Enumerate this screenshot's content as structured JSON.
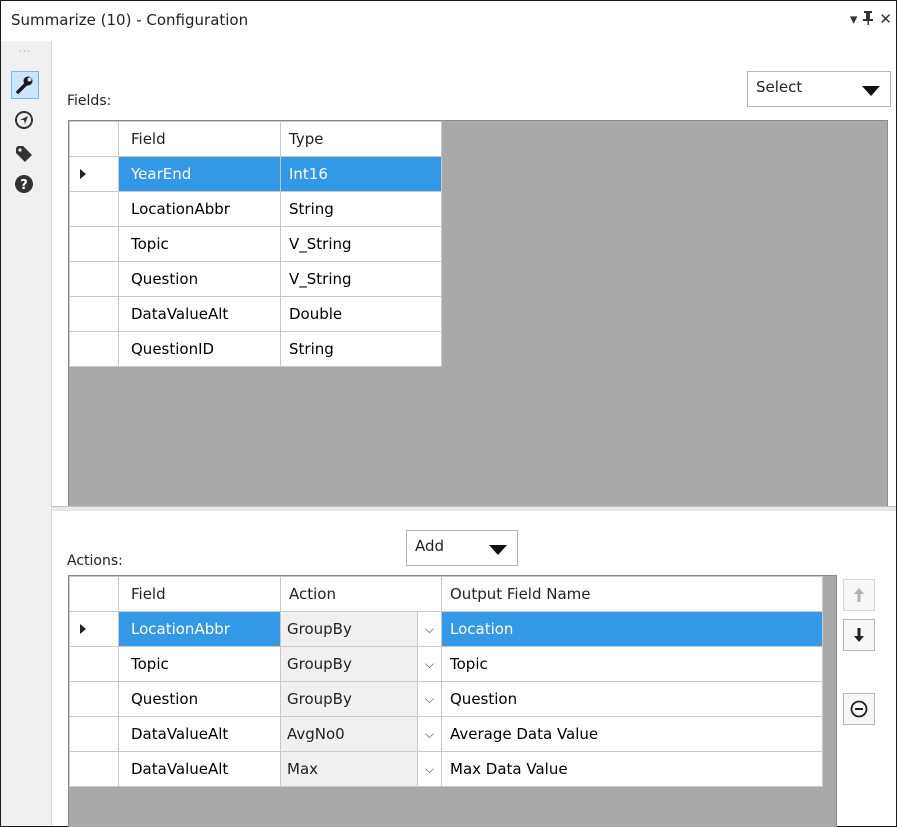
{
  "window": {
    "title": "Summarize (10) - Configuration",
    "controls": [
      "▾",
      "⊥",
      "✕"
    ]
  },
  "leftbar": {
    "items": [
      {
        "icon": "wrench-icon",
        "active": true
      },
      {
        "icon": "navigator-icon",
        "active": false
      },
      {
        "icon": "tag-icon",
        "active": false
      },
      {
        "icon": "help-icon",
        "active": false
      }
    ]
  },
  "fields_section": {
    "label": "Fields:",
    "select_dropdown": "Select",
    "columns": [
      "Field",
      "Type"
    ],
    "rows": [
      {
        "field": "YearEnd",
        "type": "Int16",
        "selected": true
      },
      {
        "field": "LocationAbbr",
        "type": "String",
        "selected": false
      },
      {
        "field": "Topic",
        "type": "V_String",
        "selected": false
      },
      {
        "field": "Question",
        "type": "V_String",
        "selected": false
      },
      {
        "field": "DataValueAlt",
        "type": "Double",
        "selected": false
      },
      {
        "field": "QuestionID",
        "type": "String",
        "selected": false
      }
    ]
  },
  "actions_section": {
    "label": "Actions:",
    "add_dropdown": "Add",
    "columns": [
      "Field",
      "Action",
      "Output Field Name"
    ],
    "rows": [
      {
        "field": "LocationAbbr",
        "action": "GroupBy",
        "output": "Location",
        "selected": true
      },
      {
        "field": "Topic",
        "action": "GroupBy",
        "output": "Topic",
        "selected": false
      },
      {
        "field": "Question",
        "action": "GroupBy",
        "output": "Question",
        "selected": false
      },
      {
        "field": "DataValueAlt",
        "action": "AvgNo0",
        "output": "Average Data Value",
        "selected": false
      },
      {
        "field": "DataValueAlt",
        "action": "Max",
        "output": "Max Data Value",
        "selected": false
      }
    ],
    "side_buttons": [
      "move-up-icon",
      "move-down-icon",
      "remove-icon"
    ]
  }
}
